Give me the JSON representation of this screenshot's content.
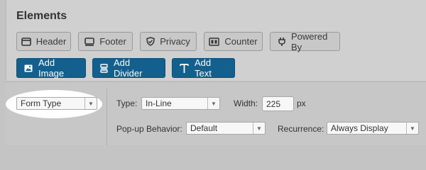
{
  "elements": {
    "title": "Elements",
    "row1": [
      {
        "label": "Header",
        "icon": "header-icon"
      },
      {
        "label": "Footer",
        "icon": "footer-icon"
      },
      {
        "label": "Privacy",
        "icon": "shield-icon"
      },
      {
        "label": "Counter",
        "icon": "counter-icon"
      },
      {
        "label": "Powered By",
        "icon": "plug-icon"
      }
    ],
    "row2": [
      {
        "label": "Add Image",
        "icon": "image-icon"
      },
      {
        "label": "Add Divider",
        "icon": "divider-icon"
      },
      {
        "label": "Add Text",
        "icon": "text-icon"
      }
    ]
  },
  "settings": {
    "form_type": {
      "value": "Form Type"
    },
    "type": {
      "label": "Type:",
      "value": "In-Line"
    },
    "width": {
      "label": "Width:",
      "value": "225",
      "unit": "px"
    },
    "popup_behavior": {
      "label": "Pop-up Behavior:",
      "value": "Default"
    },
    "recurrence": {
      "label": "Recurrence:",
      "value": "Always Display"
    }
  },
  "colors": {
    "primary_button": "#135f8e",
    "highlight": "#ffffff"
  }
}
